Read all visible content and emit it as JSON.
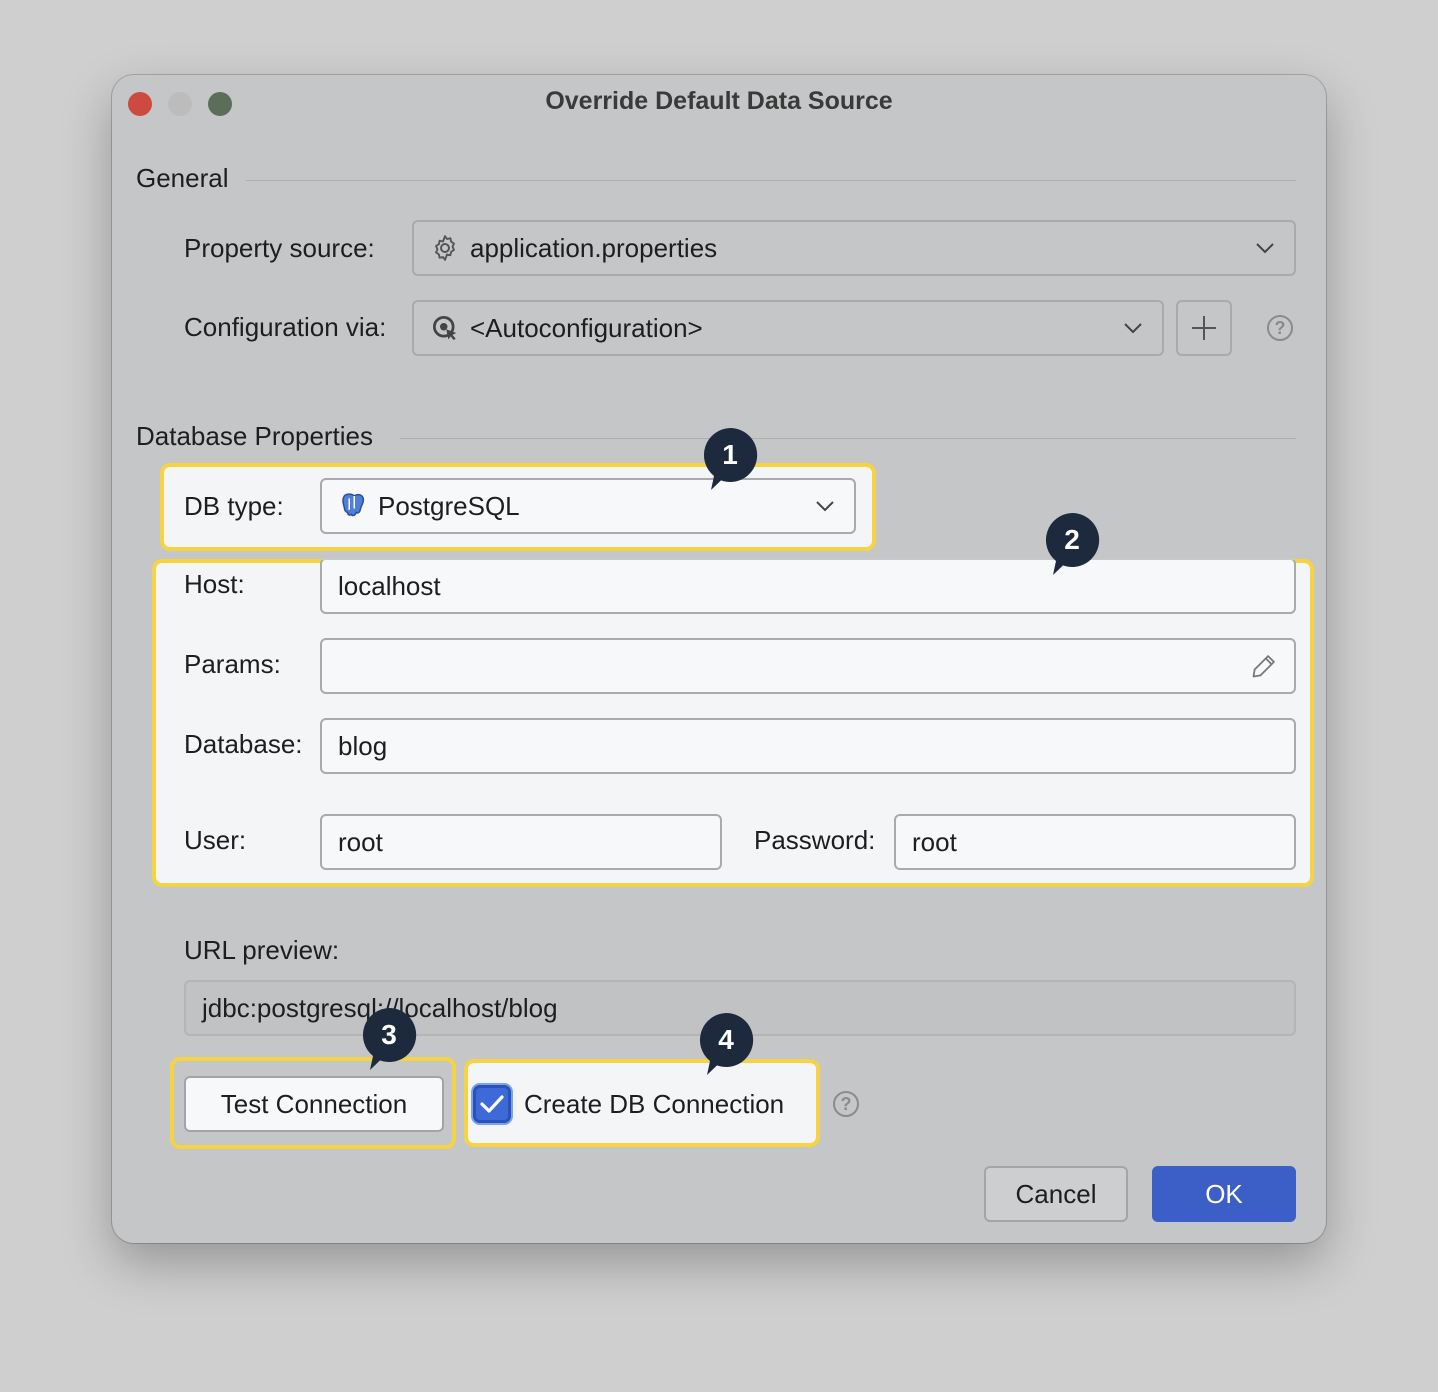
{
  "window": {
    "title": "Override Default Data Source"
  },
  "general": {
    "section_title": "General",
    "property_source_label": "Property source:",
    "property_source_value": "application.properties",
    "property_source_icon": "gear-icon",
    "configuration_via_label": "Configuration via:",
    "configuration_via_value": "<Autoconfiguration>",
    "configuration_via_icon": "autoconfig-icon",
    "add_icon": "plus-icon",
    "help_icon": "question-circle-icon"
  },
  "database": {
    "section_title": "Database Properties",
    "db_type_label": "DB type:",
    "db_type_value": "PostgreSQL",
    "db_type_icon": "postgresql-elephant-icon",
    "host_label": "Host:",
    "host_value": "localhost",
    "params_label": "Params:",
    "params_value": "",
    "params_edit_icon": "pencil-icon",
    "database_label": "Database:",
    "database_value": "blog",
    "user_label": "User:",
    "user_value": "root",
    "password_label": "Password:",
    "password_value": "root"
  },
  "url_preview": {
    "label": "URL preview:",
    "value": "jdbc:postgresql://localhost/blog"
  },
  "actions": {
    "test_connection": "Test Connection",
    "create_db_connection": "Create DB Connection",
    "create_db_connection_checked": true,
    "cancel": "Cancel",
    "ok": "OK"
  },
  "callouts": [
    "1",
    "2",
    "3",
    "4"
  ],
  "colors": {
    "highlight": "#f5d342",
    "callout": "#1d2a3e",
    "primary_button": "#3b5fc6",
    "checkbox": "#3d6ad6"
  }
}
